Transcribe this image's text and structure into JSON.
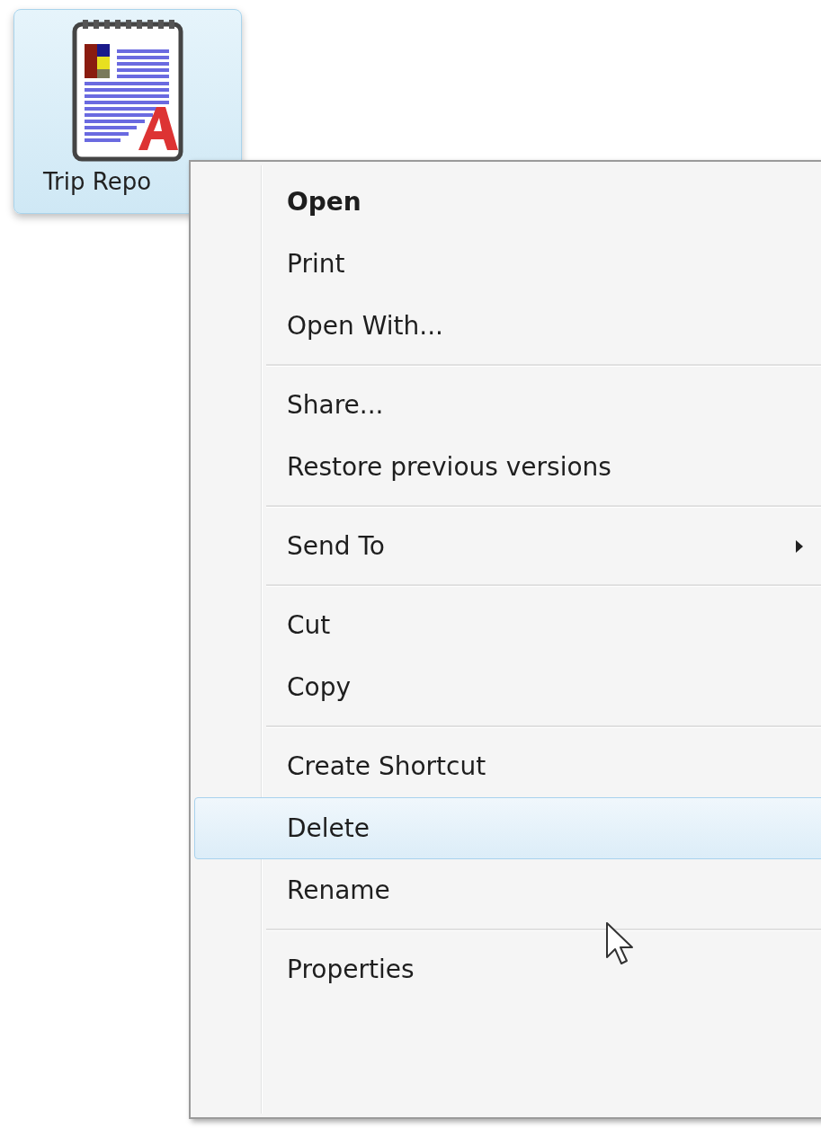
{
  "desktop_icon": {
    "label": "Trip Repo",
    "selected": true
  },
  "context_menu": {
    "groups": [
      {
        "items": [
          {
            "label": "Open",
            "default": true,
            "selected": false,
            "submenu": false
          },
          {
            "label": "Print",
            "default": false,
            "selected": false,
            "submenu": false
          },
          {
            "label": "Open With...",
            "default": false,
            "selected": false,
            "submenu": false
          }
        ]
      },
      {
        "items": [
          {
            "label": "Share...",
            "default": false,
            "selected": false,
            "submenu": false
          },
          {
            "label": "Restore previous versions",
            "default": false,
            "selected": false,
            "submenu": false
          }
        ]
      },
      {
        "items": [
          {
            "label": "Send To",
            "default": false,
            "selected": false,
            "submenu": true
          }
        ]
      },
      {
        "items": [
          {
            "label": "Cut",
            "default": false,
            "selected": false,
            "submenu": false
          },
          {
            "label": "Copy",
            "default": false,
            "selected": false,
            "submenu": false
          }
        ]
      },
      {
        "items": [
          {
            "label": "Create Shortcut",
            "default": false,
            "selected": false,
            "submenu": false
          },
          {
            "label": "Delete",
            "default": false,
            "selected": true,
            "submenu": false
          },
          {
            "label": "Rename",
            "default": false,
            "selected": false,
            "submenu": false
          }
        ]
      },
      {
        "items": [
          {
            "label": "Properties",
            "default": false,
            "selected": false,
            "submenu": false
          }
        ]
      }
    ]
  }
}
